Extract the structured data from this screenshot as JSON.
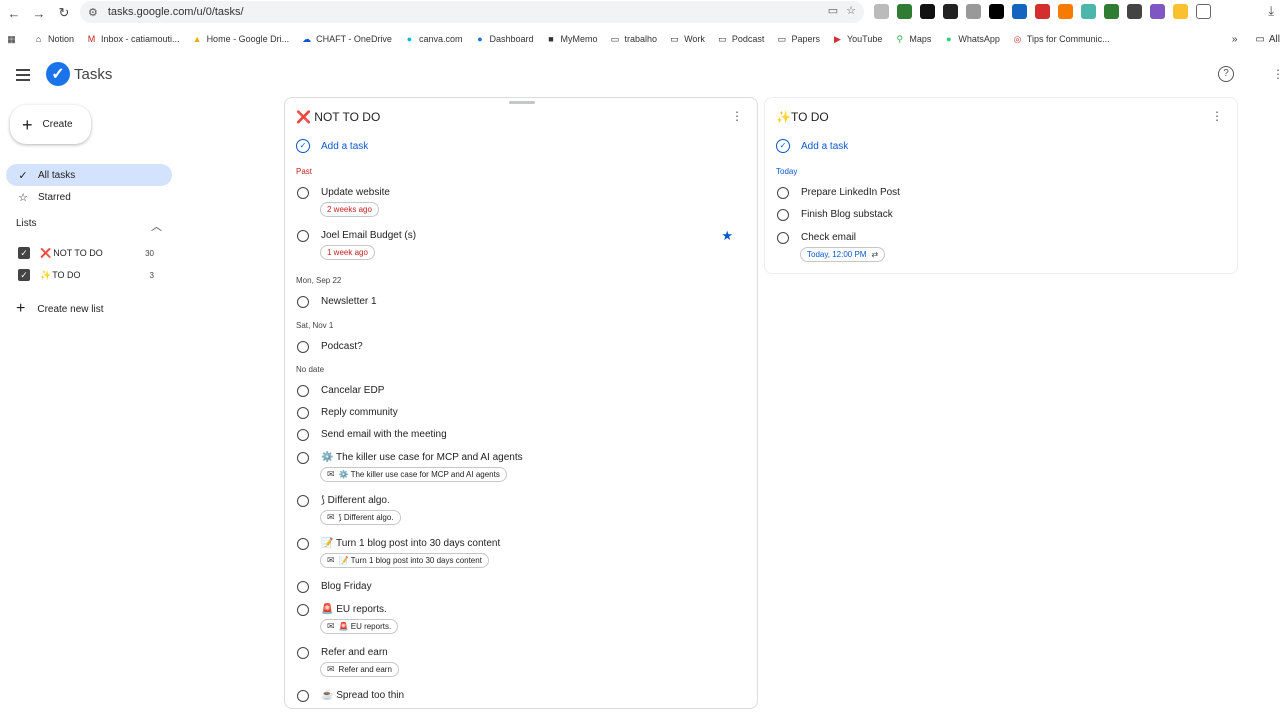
{
  "browser": {
    "url": "tasks.google.com/u/0/tasks/",
    "bookmarks": [
      "Notion",
      "Inbox - catiamouti...",
      "Home - Google Dri...",
      "CHAFT - OneDrive",
      "canva.com",
      "Dashboard",
      "MyMemo",
      "trabalho",
      "Work",
      "Podcast",
      "Papers",
      "YouTube",
      "Maps",
      "WhatsApp",
      "Tips for Communic..."
    ],
    "bookmarks_more": "All"
  },
  "app": {
    "title": "Tasks"
  },
  "sidebar": {
    "create_label": "Create",
    "nav": [
      {
        "label": "All tasks",
        "icon": "task-check-icon",
        "active": true
      },
      {
        "label": "Starred",
        "icon": "star-outline-icon",
        "active": false
      }
    ],
    "lists_heading": "Lists",
    "lists": [
      {
        "label": "NOT TO DO",
        "emoji": "❌",
        "count": "30"
      },
      {
        "label": "TO DO",
        "emoji": "✨",
        "count": "3"
      }
    ],
    "create_list_label": "Create new list"
  },
  "panel_not_to_do": {
    "emoji": "❌",
    "title": "NOT TO DO",
    "add_task_label": "Add a task",
    "sections": {
      "past": "Past",
      "sep22": "Mon, Sep 22",
      "nov1": "Sat, Nov 1",
      "nodate": "No date"
    },
    "tasks": [
      {
        "title": "Update website",
        "chip": "2 weeks ago"
      },
      {
        "title": "Joel Email Budget (s)",
        "chip": "1 week ago",
        "starred": true
      },
      {
        "title": "Newsletter 1"
      },
      {
        "title": "Podcast?"
      },
      {
        "title": "Cancelar EDP"
      },
      {
        "title": "Reply community"
      },
      {
        "title": "Send email with the meeting"
      },
      {
        "title": "⚙️ The killer use case for MCP and AI agents",
        "chip": "⚙️ The killer use case for MCP and AI agents"
      },
      {
        "title": "⟆ Different algo.",
        "chip": "⟆ Different algo."
      },
      {
        "title": "📝 Turn 1 blog post into 30 days content",
        "chip": "📝 Turn 1 blog post into 30 days content"
      },
      {
        "title": "Blog Friday"
      },
      {
        "title": "🚨 EU reports.",
        "chip": "🚨 EU reports."
      },
      {
        "title": "Refer and earn",
        "chip": "Refer and earn"
      },
      {
        "title": "☕ Spread too thin"
      }
    ]
  },
  "panel_to_do": {
    "emoji": "✨",
    "title": "TO DO",
    "add_task_label": "Add a task",
    "section_today": "Today",
    "tasks": [
      {
        "title": "Prepare LinkedIn Post"
      },
      {
        "title": "Finish Blog substack"
      },
      {
        "title": "Check email",
        "chip": "Today, 12:00 PM"
      }
    ]
  },
  "colors": {
    "accent": "#0b57d0",
    "overdue": "#c5221f",
    "active_nav": "#d3e3fd"
  }
}
